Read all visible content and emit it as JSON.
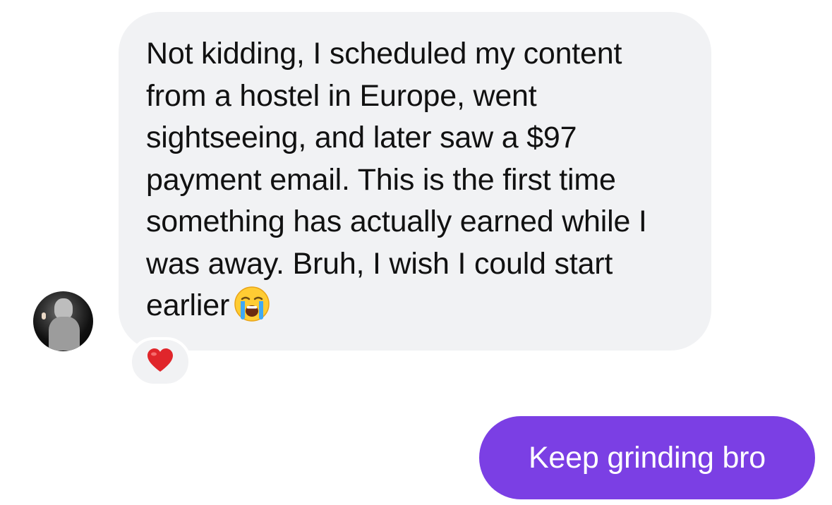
{
  "conversation": {
    "incoming": {
      "text": "Not kidding, I scheduled my content from a hostel in Europe, went sightseeing, and later saw a $97 payment email. This is the first time something has actually earned while I was away. Bruh, I wish I could start earlier",
      "emoji": "loudly-crying-face-icon",
      "reaction": "red-heart-icon"
    },
    "outgoing": {
      "text": "Keep grinding bro"
    }
  },
  "colors": {
    "incoming_bubble": "#f1f2f4",
    "outgoing_bubble": "#7b3fe4",
    "incoming_text": "#111111",
    "outgoing_text": "#ffffff",
    "heart": "#e0262b"
  }
}
